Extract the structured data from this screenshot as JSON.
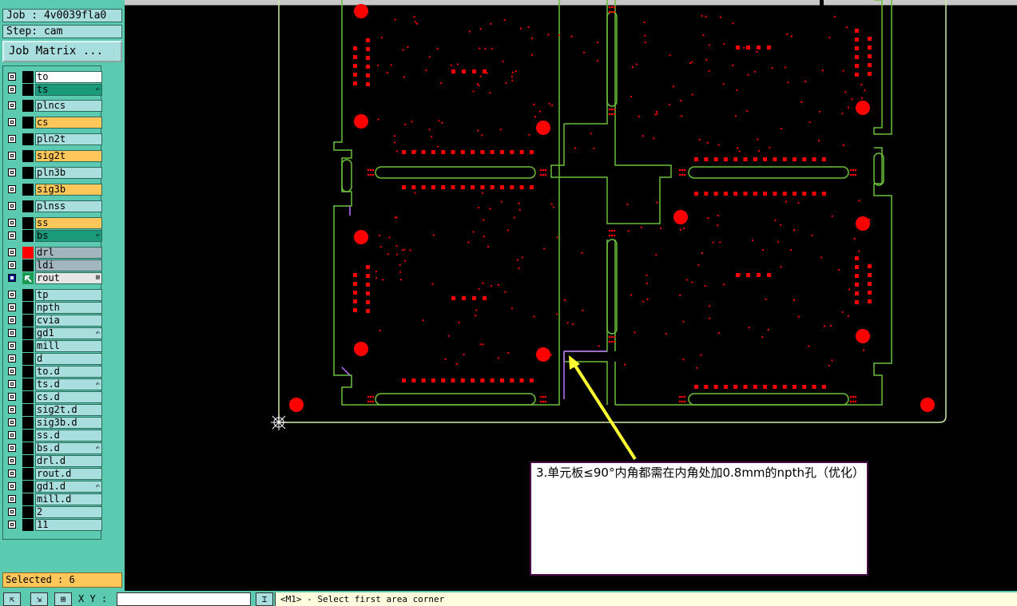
{
  "job": {
    "label": "Job : 4v0039fla0"
  },
  "step": {
    "label": "Step: cam"
  },
  "matrix_button": "Job Matrix ...",
  "layers": [
    {
      "name": "to",
      "color": "#ffffff",
      "swatch": "black"
    },
    {
      "name": "ts",
      "color": "#1a9a7a",
      "swatch": "black",
      "mark": "✍"
    },
    {
      "name": "plncs",
      "color": "#a8dede",
      "swatch": "black"
    },
    {
      "name": "cs",
      "color": "#ffc75a",
      "swatch": "black"
    },
    {
      "name": "pln2t",
      "color": "#a8dede",
      "swatch": "black"
    },
    {
      "name": "sig2t",
      "color": "#ffc75a",
      "swatch": "black"
    },
    {
      "name": "pln3b",
      "color": "#a8dede",
      "swatch": "black"
    },
    {
      "name": "sig3b",
      "color": "#ffc75a",
      "swatch": "black"
    },
    {
      "name": "plnss",
      "color": "#a8dede",
      "swatch": "black"
    },
    {
      "name": "ss",
      "color": "#ffc75a",
      "swatch": "black"
    },
    {
      "name": "bs",
      "color": "#1a9a7a",
      "swatch": "black",
      "mark": "✍"
    },
    {
      "name": "drl",
      "color": "#a3b5bf",
      "swatch": "red"
    },
    {
      "name": "ldi",
      "color": "#a3b5bf",
      "swatch": "black"
    },
    {
      "name": "rout",
      "color": "#e6e6e6",
      "swatch": "green",
      "selected": true,
      "mark": "⊞"
    },
    {
      "name": "tp",
      "color": "#a8dede",
      "swatch": "black"
    },
    {
      "name": "npth",
      "color": "#a8dede",
      "swatch": "black"
    },
    {
      "name": "cvia",
      "color": "#a8dede",
      "swatch": "black"
    },
    {
      "name": "gd1",
      "color": "#a8dede",
      "swatch": "black",
      "mark": "✍"
    },
    {
      "name": "mill",
      "color": "#a8dede",
      "swatch": "black"
    },
    {
      "name": "d",
      "color": "#a8dede",
      "swatch": "black"
    },
    {
      "name": "to.d",
      "color": "#a8dede",
      "swatch": "black"
    },
    {
      "name": "ts.d",
      "color": "#a8dede",
      "swatch": "black",
      "mark": "✍"
    },
    {
      "name": "cs.d",
      "color": "#a8dede",
      "swatch": "black"
    },
    {
      "name": "sig2t.d",
      "color": "#a8dede",
      "swatch": "black"
    },
    {
      "name": "sig3b.d",
      "color": "#a8dede",
      "swatch": "black"
    },
    {
      "name": "ss.d",
      "color": "#a8dede",
      "swatch": "black"
    },
    {
      "name": "bs.d",
      "color": "#a8dede",
      "swatch": "black",
      "mark": "✍"
    },
    {
      "name": "drl.d",
      "color": "#a8dede",
      "swatch": "black"
    },
    {
      "name": "rout.d",
      "color": "#a8dede",
      "swatch": "black"
    },
    {
      "name": "gd1.d",
      "color": "#a8dede",
      "swatch": "black",
      "mark": "✍"
    },
    {
      "name": "mill.d",
      "color": "#a8dede",
      "swatch": "black"
    },
    {
      "name": "2",
      "color": "#a8dede",
      "swatch": "black"
    },
    {
      "name": "11",
      "color": "#a8dede",
      "swatch": "black"
    }
  ],
  "selected_label": "Selected : 6",
  "callout_text": "3.单元板≤90°内角都需在内角处加0.8mm的npth孔（优化）",
  "xy_label": "X Y :",
  "xy_value": "",
  "status_message": "<M1> - Select first area corner",
  "colors": {
    "panel_bg": "#5ccab0",
    "outline": "#7fd84a",
    "pad": "#ff0000",
    "route": "#6abf3a",
    "arrow": "#ffff33",
    "purple": "#c070ff"
  }
}
